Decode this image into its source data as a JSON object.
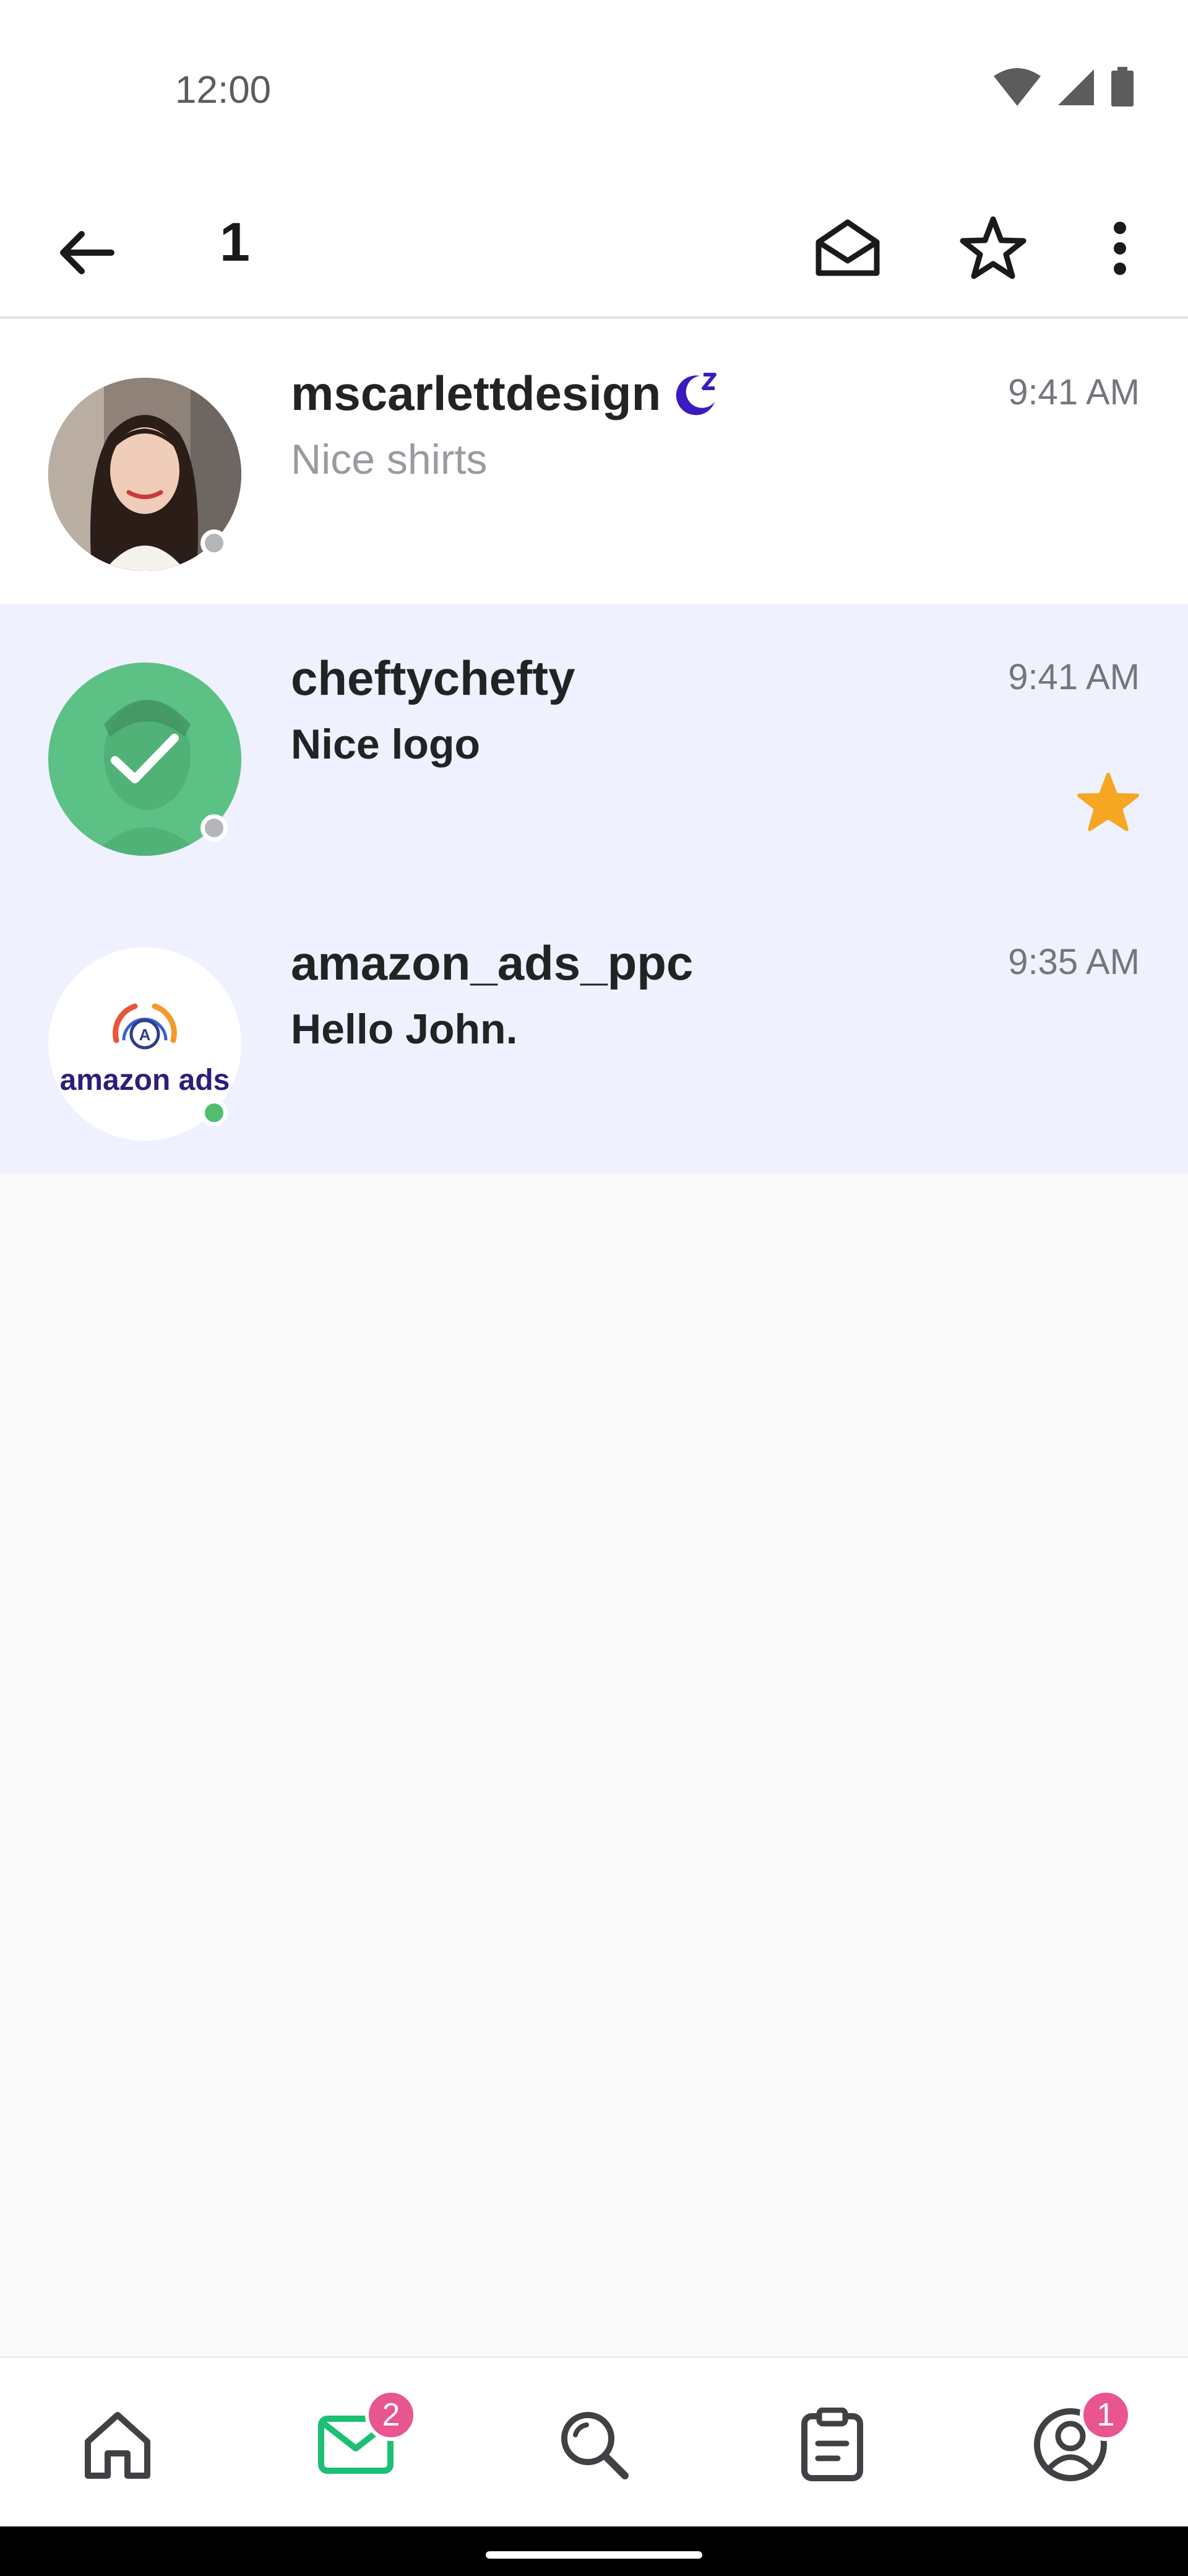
{
  "status_bar": {
    "time": "12:00",
    "icons": [
      "wifi-icon",
      "signal-icon",
      "battery-icon"
    ]
  },
  "app_bar": {
    "selected_count": "1",
    "actions": [
      "back-arrow-icon",
      "mark-read-envelope-icon",
      "star-outline-icon",
      "more-vert-icon"
    ]
  },
  "conversations": [
    {
      "username": "mscarlettdesign",
      "preview": "Nice shirts",
      "time": "9:41 AM",
      "unread": false,
      "away": true,
      "online": false,
      "starred": false,
      "selected": false
    },
    {
      "username": "cheftychefty",
      "preview": "Nice logo",
      "time": "9:41 AM",
      "unread": true,
      "away": false,
      "online": false,
      "starred": true,
      "selected": true
    },
    {
      "username": "amazon_ads_ppc",
      "preview": "Hello John.",
      "time": "9:35 AM",
      "unread": true,
      "away": false,
      "online": true,
      "starred": false,
      "selected": false,
      "avatar_logo": "amazon ads"
    }
  ],
  "bottom_nav": {
    "items": [
      {
        "icon": "home-icon",
        "active": false,
        "badge": ""
      },
      {
        "icon": "inbox-icon",
        "active": true,
        "badge": "2"
      },
      {
        "icon": "search-icon",
        "active": false,
        "badge": ""
      },
      {
        "icon": "orders-clipboard-icon",
        "active": false,
        "badge": ""
      },
      {
        "icon": "profile-icon",
        "active": false,
        "badge": "1"
      }
    ]
  },
  "colors": {
    "accent_green": "#1dbf73",
    "unread_bg": "#eff1fe",
    "star": "#f5a623",
    "away_purple": "#3b1bbf",
    "badge": "#e8558f"
  }
}
